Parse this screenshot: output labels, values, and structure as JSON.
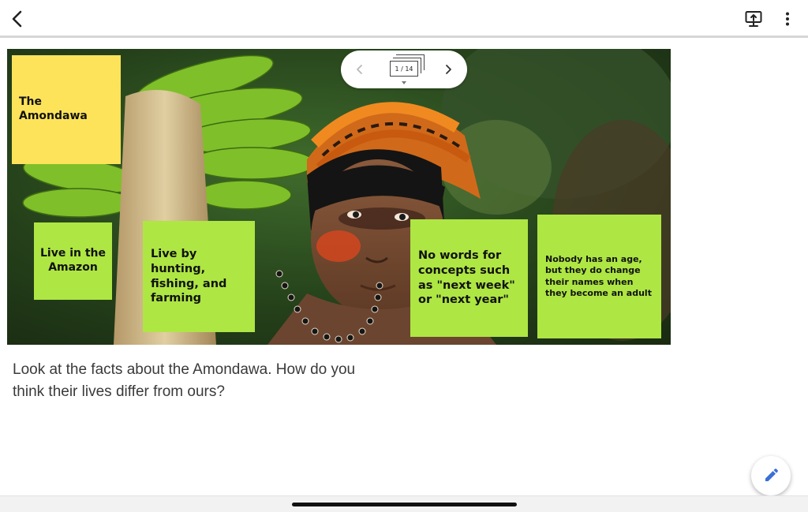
{
  "toolbar": {
    "back_icon": "chevron-left-icon",
    "present_icon": "present-to-screen-icon",
    "more_icon": "more-vert-icon"
  },
  "slide": {
    "pager": {
      "counter": "1 / 14",
      "prev_icon": "chevron-left-icon",
      "next_icon": "chevron-right-icon"
    },
    "notes": [
      {
        "id": "title",
        "text": "The Amondawa",
        "color": "#fde35a"
      },
      {
        "id": "amazon",
        "text": "Live in the Amazon",
        "color": "#aee643"
      },
      {
        "id": "hunting",
        "text": "Live by hunting, fishing, and farming",
        "color": "#aee643"
      },
      {
        "id": "words",
        "text": "No words for concepts such as \"next week\" or \"next year\"",
        "color": "#aee643"
      },
      {
        "id": "age",
        "text": "Nobody has an age, but they do change their names when they become an adult",
        "color": "#aee643"
      }
    ]
  },
  "caption": "Look at the facts about the Amondawa.  How do you think their lives differ from ours?",
  "fab": {
    "icon": "pencil-icon"
  }
}
